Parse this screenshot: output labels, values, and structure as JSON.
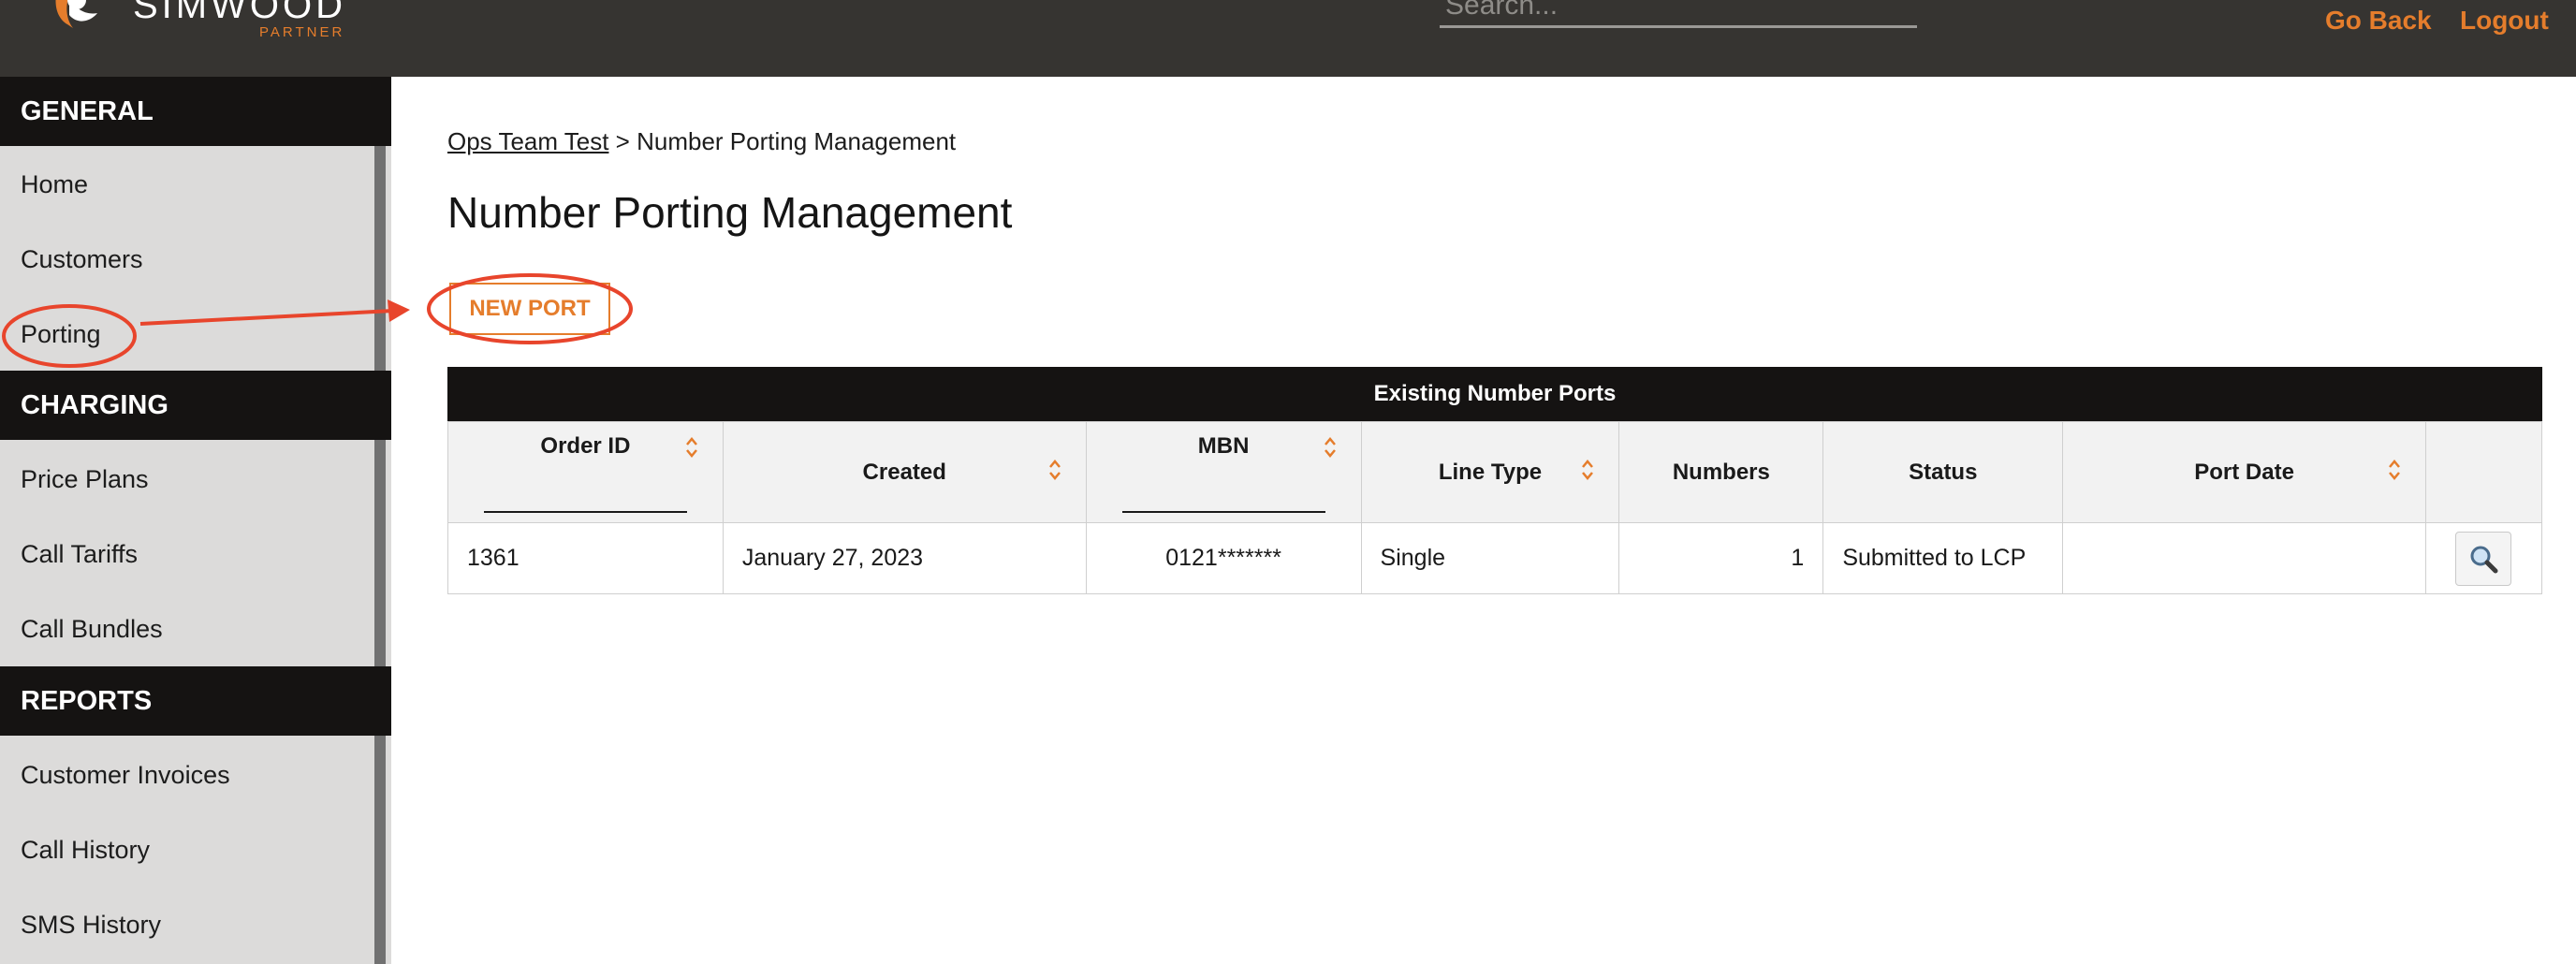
{
  "header": {
    "logo_text": "SIMWOOD",
    "logo_sub": "PARTNER",
    "search_placeholder": "Search...",
    "go_back": "Go Back",
    "logout": "Logout"
  },
  "sidebar": {
    "sections": [
      {
        "title": "GENERAL",
        "items": [
          "Home",
          "Customers",
          "Porting"
        ]
      },
      {
        "title": "CHARGING",
        "items": [
          "Price Plans",
          "Call Tariffs",
          "Call Bundles"
        ]
      },
      {
        "title": "REPORTS",
        "items": [
          "Customer Invoices",
          "Call History",
          "SMS History"
        ]
      }
    ]
  },
  "breadcrumb": {
    "parent": "Ops Team Test",
    "separator": " > ",
    "current": "Number Porting Management"
  },
  "page": {
    "title": "Number Porting Management",
    "new_port_label": "NEW PORT"
  },
  "table": {
    "caption": "Existing Number Ports",
    "columns": [
      "Order ID",
      "Created",
      "MBN",
      "Line Type",
      "Numbers",
      "Status",
      "Port Date",
      ""
    ],
    "rows": [
      {
        "order_id": "1361",
        "created": "January 27, 2023",
        "mbn": "0121*******",
        "line_type": "Single",
        "numbers": "1",
        "status": "Submitted to LCP",
        "port_date": ""
      }
    ]
  },
  "colors": {
    "accent": "#e57d2c",
    "header_bg": "#363431",
    "section_bg": "#151312",
    "sidebar_bg": "#dcdbda",
    "annotation": "#e8452c"
  },
  "icons": [
    "simwood-logo-icon",
    "sort-icon",
    "magnifier-icon"
  ]
}
